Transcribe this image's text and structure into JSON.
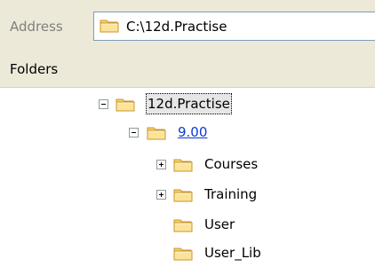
{
  "address": {
    "label": "Address",
    "path": "C:\\12d.Practise"
  },
  "folders_pane": {
    "title": "Folders"
  },
  "tree": {
    "root": {
      "label": "12d.Practise",
      "expander": "minus"
    },
    "version": {
      "label": "9.00",
      "expander": "minus"
    },
    "children": [
      {
        "label": "Courses",
        "expander": "plus"
      },
      {
        "label": "Training",
        "expander": "plus"
      },
      {
        "label": "User",
        "expander": "none"
      },
      {
        "label": "User_Lib",
        "expander": "none"
      }
    ]
  },
  "colors": {
    "toolbar_bg": "#ece9d8",
    "folder_yellow": "#f6d26b",
    "link_blue": "#0b3ccf"
  }
}
